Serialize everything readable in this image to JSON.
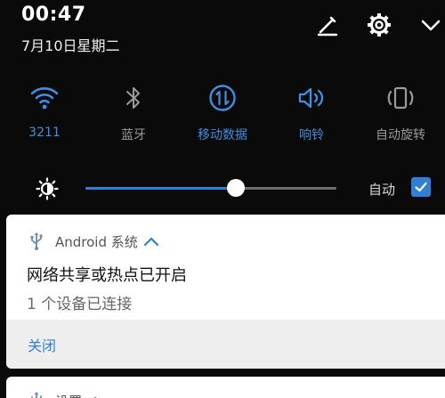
{
  "status": {
    "time": "00:47",
    "date": "7月10日星期二"
  },
  "header_icons": [
    "edit-icon",
    "settings-icon",
    "expand-icon"
  ],
  "toggles": [
    {
      "label": "3211",
      "icon": "wifi-icon",
      "on": true
    },
    {
      "label": "蓝牙",
      "icon": "bluetooth-icon",
      "on": false
    },
    {
      "label": "移动数据",
      "icon": "mobile-data-icon",
      "on": true
    },
    {
      "label": "响铃",
      "icon": "ringer-icon",
      "on": true
    },
    {
      "label": "自动旋转",
      "icon": "auto-rotate-icon",
      "on": false
    }
  ],
  "brightness": {
    "level": 0.6,
    "auto_label": "自动",
    "auto_checked": true
  },
  "notifications": [
    {
      "app": "Android 系统",
      "title": "网络共享或热点已开启",
      "text": "1 个设备已连接",
      "action": "关闭"
    },
    {
      "app": "设置"
    }
  ],
  "colors": {
    "accent": "#2f7fd6",
    "background": "#0a0a0a"
  }
}
